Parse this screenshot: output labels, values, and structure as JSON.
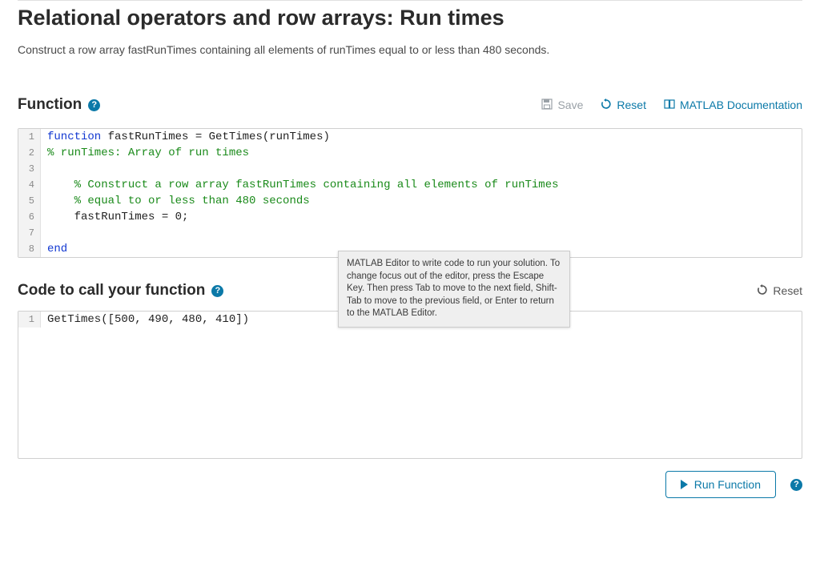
{
  "title": "Relational operators and row arrays: Run times",
  "instructions": "Construct a row array fastRunTimes containing all elements of runTimes equal to or less than 480 seconds.",
  "function_section": {
    "title": "Function",
    "help_glyph": "?",
    "save_label": "Save",
    "reset_label": "Reset",
    "doc_label": "MATLAB Documentation"
  },
  "editor1": {
    "lines": [
      {
        "n": "1",
        "segments": [
          {
            "t": "function",
            "cls": "kw"
          },
          {
            "t": " fastRunTimes = GetTimes(runTimes)",
            "cls": "plain"
          }
        ]
      },
      {
        "n": "2",
        "segments": [
          {
            "t": "% runTimes: Array of run times",
            "cls": "com"
          }
        ]
      },
      {
        "n": "3",
        "segments": [
          {
            "t": "",
            "cls": "plain"
          }
        ]
      },
      {
        "n": "4",
        "segments": [
          {
            "t": "    % Construct a row array fastRunTimes containing all elements of runTimes",
            "cls": "com"
          }
        ]
      },
      {
        "n": "5",
        "segments": [
          {
            "t": "    % equal to or less than 480 seconds",
            "cls": "com"
          }
        ]
      },
      {
        "n": "6",
        "segments": [
          {
            "t": "    fastRunTimes = 0;",
            "cls": "plain"
          }
        ]
      },
      {
        "n": "7",
        "segments": [
          {
            "t": "",
            "cls": "plain"
          }
        ]
      },
      {
        "n": "8",
        "segments": [
          {
            "t": "end",
            "cls": "kw"
          }
        ]
      }
    ]
  },
  "tooltip_text": "MATLAB Editor to write code to run your solution. To change focus out of the editor, press the Escape Key. Then press Tab to move to the next field, Shift-Tab to move to the previous field, or Enter to return to the MATLAB Editor.",
  "call_section": {
    "title": "Code to call your function",
    "help_glyph": "?",
    "reset_label": "Reset"
  },
  "editor2": {
    "lines": [
      {
        "n": "1",
        "segments": [
          {
            "t": "GetTimes([500, 490, 480, 410])",
            "cls": "plain"
          }
        ]
      }
    ]
  },
  "run_label": "Run Function",
  "help_glyph": "?"
}
